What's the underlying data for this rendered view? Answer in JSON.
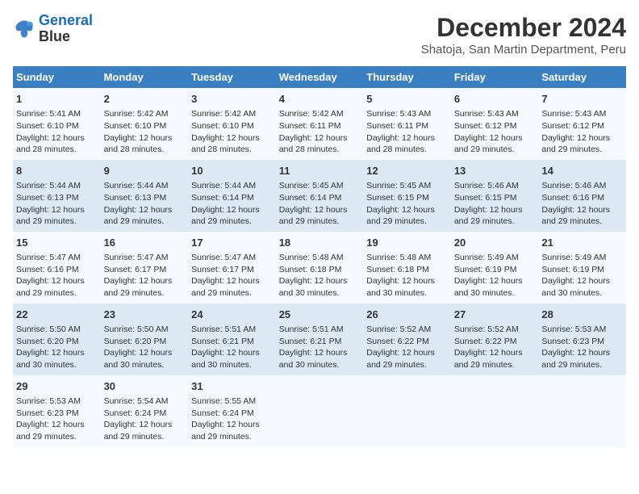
{
  "logo": {
    "line1": "General",
    "line2": "Blue"
  },
  "title": "December 2024",
  "subtitle": "Shatoja, San Martin Department, Peru",
  "weekdays": [
    "Sunday",
    "Monday",
    "Tuesday",
    "Wednesday",
    "Thursday",
    "Friday",
    "Saturday"
  ],
  "weeks": [
    [
      {
        "day": "1",
        "info": "Sunrise: 5:41 AM\nSunset: 6:10 PM\nDaylight: 12 hours\nand 28 minutes."
      },
      {
        "day": "2",
        "info": "Sunrise: 5:42 AM\nSunset: 6:10 PM\nDaylight: 12 hours\nand 28 minutes."
      },
      {
        "day": "3",
        "info": "Sunrise: 5:42 AM\nSunset: 6:10 PM\nDaylight: 12 hours\nand 28 minutes."
      },
      {
        "day": "4",
        "info": "Sunrise: 5:42 AM\nSunset: 6:11 PM\nDaylight: 12 hours\nand 28 minutes."
      },
      {
        "day": "5",
        "info": "Sunrise: 5:43 AM\nSunset: 6:11 PM\nDaylight: 12 hours\nand 28 minutes."
      },
      {
        "day": "6",
        "info": "Sunrise: 5:43 AM\nSunset: 6:12 PM\nDaylight: 12 hours\nand 29 minutes."
      },
      {
        "day": "7",
        "info": "Sunrise: 5:43 AM\nSunset: 6:12 PM\nDaylight: 12 hours\nand 29 minutes."
      }
    ],
    [
      {
        "day": "8",
        "info": "Sunrise: 5:44 AM\nSunset: 6:13 PM\nDaylight: 12 hours\nand 29 minutes."
      },
      {
        "day": "9",
        "info": "Sunrise: 5:44 AM\nSunset: 6:13 PM\nDaylight: 12 hours\nand 29 minutes."
      },
      {
        "day": "10",
        "info": "Sunrise: 5:44 AM\nSunset: 6:14 PM\nDaylight: 12 hours\nand 29 minutes."
      },
      {
        "day": "11",
        "info": "Sunrise: 5:45 AM\nSunset: 6:14 PM\nDaylight: 12 hours\nand 29 minutes."
      },
      {
        "day": "12",
        "info": "Sunrise: 5:45 AM\nSunset: 6:15 PM\nDaylight: 12 hours\nand 29 minutes."
      },
      {
        "day": "13",
        "info": "Sunrise: 5:46 AM\nSunset: 6:15 PM\nDaylight: 12 hours\nand 29 minutes."
      },
      {
        "day": "14",
        "info": "Sunrise: 5:46 AM\nSunset: 6:16 PM\nDaylight: 12 hours\nand 29 minutes."
      }
    ],
    [
      {
        "day": "15",
        "info": "Sunrise: 5:47 AM\nSunset: 6:16 PM\nDaylight: 12 hours\nand 29 minutes."
      },
      {
        "day": "16",
        "info": "Sunrise: 5:47 AM\nSunset: 6:17 PM\nDaylight: 12 hours\nand 29 minutes."
      },
      {
        "day": "17",
        "info": "Sunrise: 5:47 AM\nSunset: 6:17 PM\nDaylight: 12 hours\nand 29 minutes."
      },
      {
        "day": "18",
        "info": "Sunrise: 5:48 AM\nSunset: 6:18 PM\nDaylight: 12 hours\nand 30 minutes."
      },
      {
        "day": "19",
        "info": "Sunrise: 5:48 AM\nSunset: 6:18 PM\nDaylight: 12 hours\nand 30 minutes."
      },
      {
        "day": "20",
        "info": "Sunrise: 5:49 AM\nSunset: 6:19 PM\nDaylight: 12 hours\nand 30 minutes."
      },
      {
        "day": "21",
        "info": "Sunrise: 5:49 AM\nSunset: 6:19 PM\nDaylight: 12 hours\nand 30 minutes."
      }
    ],
    [
      {
        "day": "22",
        "info": "Sunrise: 5:50 AM\nSunset: 6:20 PM\nDaylight: 12 hours\nand 30 minutes."
      },
      {
        "day": "23",
        "info": "Sunrise: 5:50 AM\nSunset: 6:20 PM\nDaylight: 12 hours\nand 30 minutes."
      },
      {
        "day": "24",
        "info": "Sunrise: 5:51 AM\nSunset: 6:21 PM\nDaylight: 12 hours\nand 30 minutes."
      },
      {
        "day": "25",
        "info": "Sunrise: 5:51 AM\nSunset: 6:21 PM\nDaylight: 12 hours\nand 30 minutes."
      },
      {
        "day": "26",
        "info": "Sunrise: 5:52 AM\nSunset: 6:22 PM\nDaylight: 12 hours\nand 29 minutes."
      },
      {
        "day": "27",
        "info": "Sunrise: 5:52 AM\nSunset: 6:22 PM\nDaylight: 12 hours\nand 29 minutes."
      },
      {
        "day": "28",
        "info": "Sunrise: 5:53 AM\nSunset: 6:23 PM\nDaylight: 12 hours\nand 29 minutes."
      }
    ],
    [
      {
        "day": "29",
        "info": "Sunrise: 5:53 AM\nSunset: 6:23 PM\nDaylight: 12 hours\nand 29 minutes."
      },
      {
        "day": "30",
        "info": "Sunrise: 5:54 AM\nSunset: 6:24 PM\nDaylight: 12 hours\nand 29 minutes."
      },
      {
        "day": "31",
        "info": "Sunrise: 5:55 AM\nSunset: 6:24 PM\nDaylight: 12 hours\nand 29 minutes."
      },
      {
        "day": "",
        "info": ""
      },
      {
        "day": "",
        "info": ""
      },
      {
        "day": "",
        "info": ""
      },
      {
        "day": "",
        "info": ""
      }
    ]
  ]
}
